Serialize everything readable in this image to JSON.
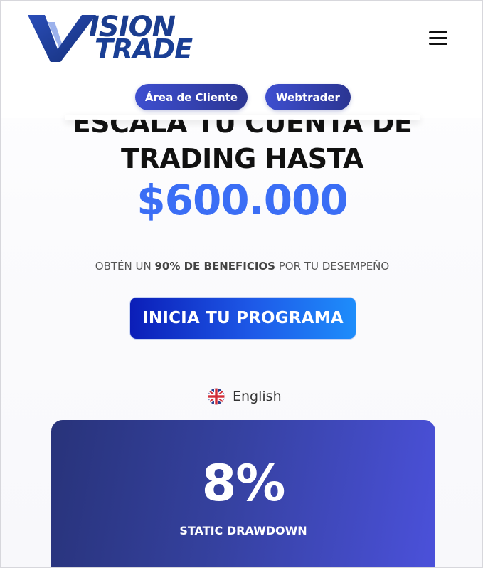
{
  "header": {
    "logo": {
      "line1": "ISION",
      "line2": "TRADE",
      "full": "VISION TRADE"
    },
    "menu_icon": "hamburger-menu-icon",
    "buttons": {
      "client_area": "Área de Cliente",
      "webtrader": "Webtrader"
    }
  },
  "hero": {
    "line1": "ESCALA TU CUENTA DE",
    "line2": "TRADING HASTA",
    "amount": "$600.000",
    "subtitle_pre": "OBTÉN UN ",
    "subtitle_bold": "90% DE BENEFICIOS",
    "subtitle_post": " POR TU DESEMPEÑO",
    "cta": "INICIA TU PROGRAMA"
  },
  "language": {
    "label": "English",
    "icon": "uk-flag-icon"
  },
  "stat_card": {
    "value": "8%",
    "label": "STATIC DRAWDOWN"
  },
  "colors": {
    "brand_blue": "#1b3d8f",
    "accent_amount": "#3b6ef5",
    "pill_start": "#3e4fd0",
    "pill_end": "#2b3592",
    "cta_start": "#0b1eb8",
    "cta_end": "#1e8dfb",
    "card_start": "#28337a",
    "card_end": "#4b51db"
  }
}
